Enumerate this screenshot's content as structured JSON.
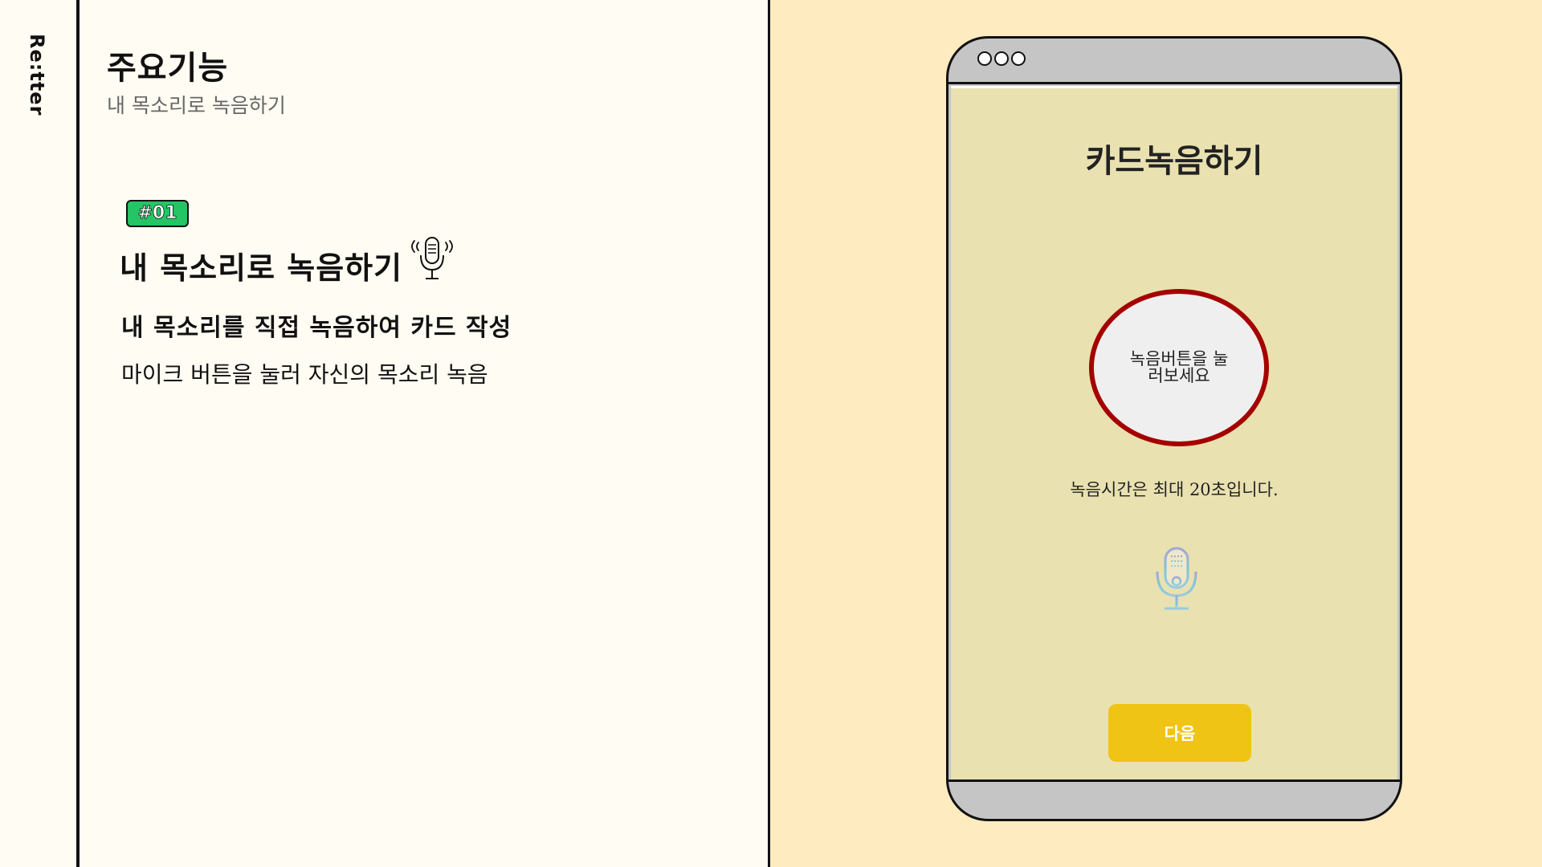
{
  "brand": "Re:tter",
  "header": {
    "title": "주요기능",
    "subtitle": "내 목소리로 녹음하기"
  },
  "feature": {
    "badge": "#01",
    "title": "내 목소리로 녹음하기",
    "icon": "microphone-outline-icon",
    "description": "내 목소리를 직접 녹음하여 카드 작성",
    "subtext": "마이크 버튼을 눌러  자신의 목소리 녹음"
  },
  "phone": {
    "screen_title": "카드녹음하기",
    "record_hint": "녹음버튼을 눌러보세요",
    "record_time": "녹음시간은 최대 20초입니다.",
    "mic_icon": "microphone-icon",
    "next_label": "다음"
  },
  "colors": {
    "left_bg": "#fffcf3",
    "right_bg": "#ffebc0",
    "badge_green": "#25c464",
    "screen_bg": "#e9e1b0",
    "ring_red": "#a50000",
    "button_yellow": "#f0c415",
    "phone_frame": "#c5c5c5"
  }
}
